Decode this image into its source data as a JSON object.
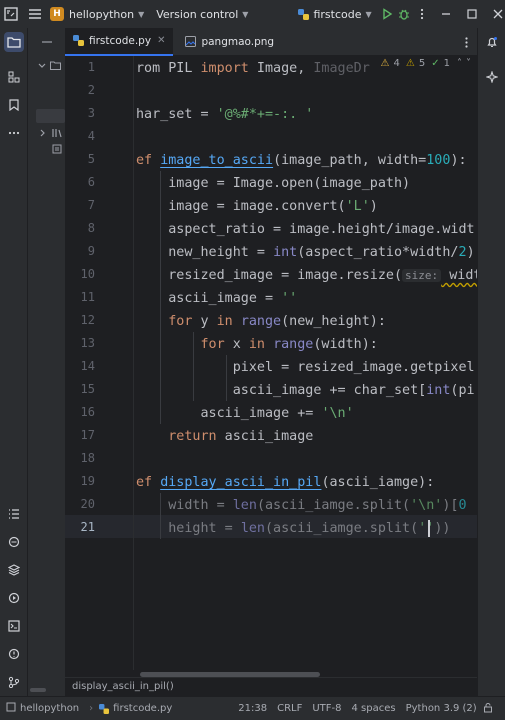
{
  "titlebar": {
    "project_initial": "H",
    "project_name": "hellopython",
    "vcs_label": "Version control",
    "run_config": "firstcode"
  },
  "tabs": [
    {
      "label": "firstcode.py",
      "active": true
    },
    {
      "label": "pangmao.png",
      "active": false
    }
  ],
  "inspections": {
    "warnings": "4",
    "weak_warnings": "5",
    "typos": "1"
  },
  "code_lines": [
    {
      "n": "1"
    },
    {
      "n": "2"
    },
    {
      "n": "3"
    },
    {
      "n": "4"
    },
    {
      "n": "5"
    },
    {
      "n": "6"
    },
    {
      "n": "7"
    },
    {
      "n": "8"
    },
    {
      "n": "9"
    },
    {
      "n": "10"
    },
    {
      "n": "11"
    },
    {
      "n": "12"
    },
    {
      "n": "13"
    },
    {
      "n": "14"
    },
    {
      "n": "15"
    },
    {
      "n": "16"
    },
    {
      "n": "17"
    },
    {
      "n": "18"
    },
    {
      "n": "19"
    },
    {
      "n": "20"
    },
    {
      "n": "21"
    }
  ],
  "code": {
    "l1_a": "rom PIL ",
    "l1_b": "import",
    "l1_c": " Image, ",
    "l1_d": "ImageDr",
    "l3_a": "har_set = ",
    "l3_b": "'@%#*+=-:. '",
    "l5_a": "ef ",
    "l5_b": "image_to_ascii",
    "l5_c": "(image_path, width=",
    "l5_d": "100",
    "l5_e": "):",
    "l6": "    image = Image.open(image_path)",
    "l7_a": "    image = image.convert(",
    "l7_b": "'L'",
    "l7_c": ")",
    "l8": "    aspect_ratio = image.height/image.widt",
    "l9_a": "    new_height = ",
    "l9_b": "int",
    "l9_c": "(aspect_ratio*width/",
    "l9_d": "2",
    "l9_e": ")",
    "l10_a": "    resized_image = image.resize(",
    "l10_hint": "size:",
    "l10_b": " widt",
    "l11_a": "    ascii_image = ",
    "l11_b": "''",
    "l12_a": "    ",
    "l12_b": "for",
    "l12_c": " y ",
    "l12_d": "in",
    "l12_e": " ",
    "l12_f": "range",
    "l12_g": "(new_height):",
    "l13_a": "        ",
    "l13_b": "for",
    "l13_c": " x ",
    "l13_d": "in",
    "l13_e": " ",
    "l13_f": "range",
    "l13_g": "(width):",
    "l14": "            pixel = resized_image.getpixel",
    "l15_a": "            ascii_image += char_set[",
    "l15_b": "int",
    "l15_c": "(pi",
    "l16_a": "        ascii_image += ",
    "l16_b": "'\\n'",
    "l17_a": "    ",
    "l17_b": "return",
    "l17_c": " ascii_image",
    "l19_a": "ef ",
    "l19_b": "display_ascii_in_pil",
    "l19_c": "(ascii_iamge):",
    "l20_a": "    width = ",
    "l20_b": "len",
    "l20_c": "(ascii_iamge.split(",
    "l20_d": "'\\n'",
    "l20_e": ")[",
    "l20_f": "0",
    "l21_a": "    height = ",
    "l21_b": "len",
    "l21_c": "(ascii_iamge.split(",
    "l21_d": "''",
    "l21_e": "))"
  },
  "breadcrumb": "display_ascii_in_pil()",
  "status": {
    "project": "hellopython",
    "file": "firstcode.py",
    "position": "21:38",
    "line_sep": "CRLF",
    "encoding": "UTF-8",
    "indent": "4 spaces",
    "interpreter": "Python 3.9 (2)"
  },
  "colors": {
    "accent": "#3574f0",
    "keyword": "#cf8e6d",
    "function": "#56a8f5",
    "string": "#6aab73",
    "number": "#2aacb8"
  }
}
